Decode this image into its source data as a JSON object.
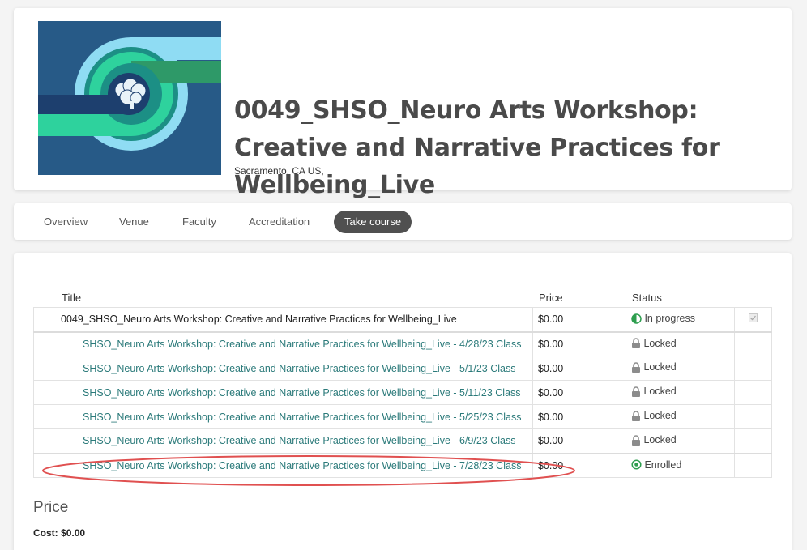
{
  "course": {
    "title": "0049_SHSO_Neuro Arts Workshop: Creative and Narrative Practices for Wellbeing_Live",
    "location": "Sacramento, CA US,",
    "thumbnail_icon": "brain-icon"
  },
  "tabs": [
    {
      "label": "Overview",
      "active": false
    },
    {
      "label": "Venue",
      "active": false
    },
    {
      "label": "Faculty",
      "active": false
    },
    {
      "label": "Accreditation",
      "active": false
    },
    {
      "label": "Take course",
      "active": true
    }
  ],
  "table": {
    "headers": {
      "title": "Title",
      "price": "Price",
      "status": "Status"
    },
    "parent": {
      "title": "0049_SHSO_Neuro Arts Workshop: Creative and Narrative Practices for Wellbeing_Live",
      "price": "$0.00",
      "status": "In progress"
    },
    "rows": [
      {
        "title": "SHSO_Neuro Arts Workshop: Creative and Narrative Practices for Wellbeing_Live - 4/28/23 Class",
        "price": "$0.00",
        "status": "Locked"
      },
      {
        "title": "SHSO_Neuro Arts Workshop: Creative and Narrative Practices for Wellbeing_Live - 5/1/23 Class",
        "price": "$0.00",
        "status": "Locked"
      },
      {
        "title": "SHSO_Neuro Arts Workshop: Creative and Narrative Practices for Wellbeing_Live - 5/11/23 Class",
        "price": "$0.00",
        "status": "Locked"
      },
      {
        "title": "SHSO_Neuro Arts Workshop: Creative and Narrative Practices for Wellbeing_Live - 5/25/23 Class",
        "price": "$0.00",
        "status": "Locked"
      },
      {
        "title": "SHSO_Neuro Arts Workshop: Creative and Narrative Practices for Wellbeing_Live - 6/9/23 Class",
        "price": "$0.00",
        "status": "Locked"
      },
      {
        "title": "SHSO_Neuro Arts Workshop: Creative and Narrative Practices for Wellbeing_Live - 7/28/23 Class",
        "price": "$0.00",
        "status": "Enrolled"
      }
    ]
  },
  "price_section": {
    "heading": "Price",
    "cost_label": "Cost:",
    "cost_value": "$0.00"
  },
  "colors": {
    "link": "#2b7a7a",
    "status_green": "#2e9e4f",
    "lock_gray": "#8c8c8c",
    "active_tab": "#505050",
    "highlight": "#e05050"
  }
}
